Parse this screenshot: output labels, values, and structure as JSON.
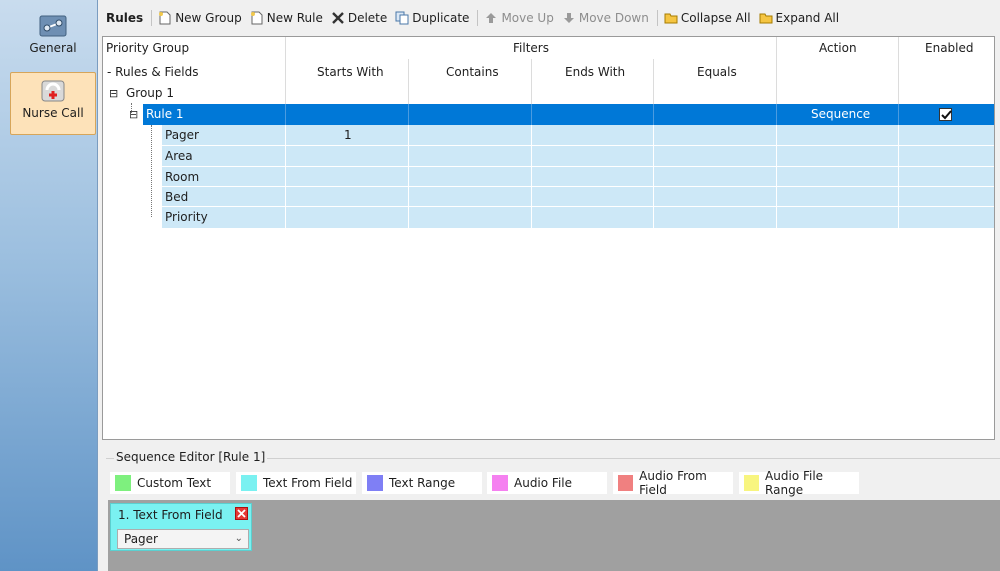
{
  "nav": {
    "items": [
      {
        "label": "General"
      },
      {
        "label": "Nurse Call",
        "selected": true
      }
    ]
  },
  "toolbar": {
    "title": "Rules",
    "buttons": [
      {
        "label": "New Group",
        "enabled": true
      },
      {
        "label": "New Rule",
        "enabled": true
      },
      {
        "label": "Delete",
        "enabled": true
      },
      {
        "label": "Duplicate",
        "enabled": true
      },
      {
        "label": "Move Up",
        "enabled": false
      },
      {
        "label": "Move Down",
        "enabled": false
      },
      {
        "label": "Collapse All",
        "enabled": true
      },
      {
        "label": "Expand All",
        "enabled": true
      }
    ]
  },
  "grid": {
    "headers": {
      "col1_top": "Priority Group",
      "col1_bottom": "- Rules & Fields",
      "filters": "Filters",
      "starts_with": "Starts With",
      "contains": "Contains",
      "ends_with": "Ends With",
      "equals": "Equals",
      "action": "Action",
      "enabled": "Enabled"
    },
    "group": {
      "toggle": "⊟",
      "label": "Group 1"
    },
    "rule": {
      "label": "Rule 1",
      "action": "Sequence",
      "enabled": true
    },
    "fields": [
      {
        "label": "Pager",
        "starts_with": "1"
      },
      {
        "label": "Area",
        "starts_with": ""
      },
      {
        "label": "Room",
        "starts_with": ""
      },
      {
        "label": "Bed",
        "starts_with": ""
      },
      {
        "label": "Priority",
        "starts_with": ""
      }
    ]
  },
  "sequence_editor": {
    "title": "Sequence Editor [Rule 1]",
    "palette": [
      {
        "label": "Custom Text",
        "color": "#7ef07e"
      },
      {
        "label": "Text From Field",
        "color": "#7af1f1"
      },
      {
        "label": "Text Range",
        "color": "#7f7ff5"
      },
      {
        "label": "Audio File",
        "color": "#f580f0"
      },
      {
        "label": "Audio From Field",
        "color": "#f08080"
      },
      {
        "label": "Audio File Range",
        "color": "#f8f57f"
      }
    ],
    "card": {
      "title": "1. Text From Field",
      "value": "Pager"
    }
  }
}
